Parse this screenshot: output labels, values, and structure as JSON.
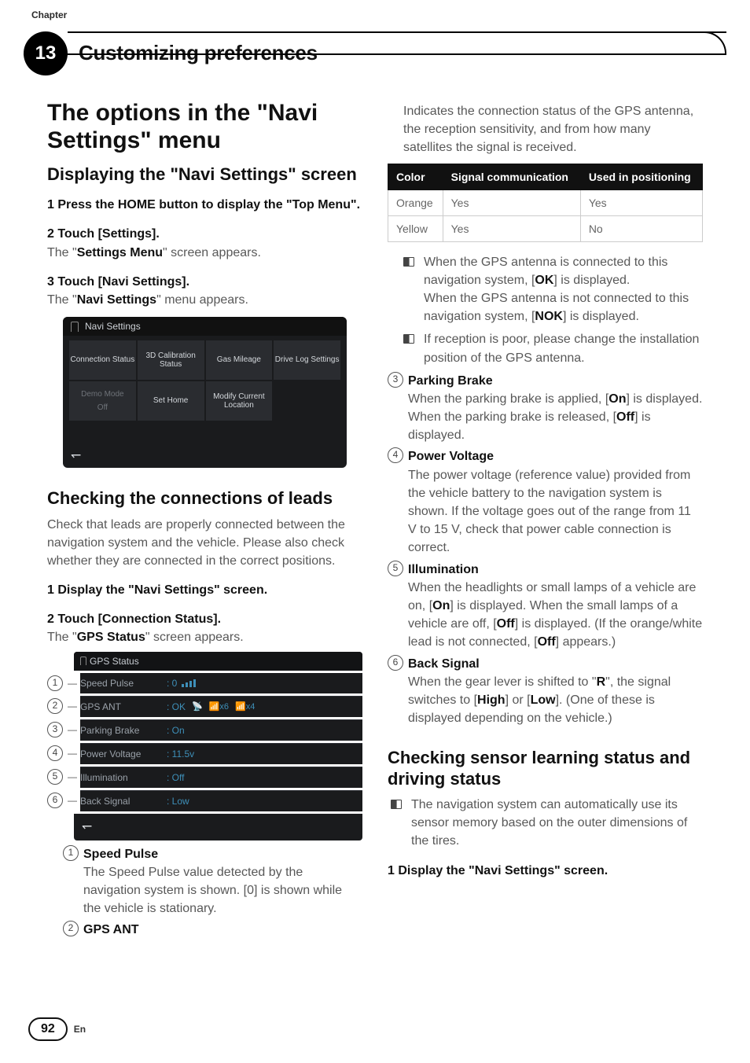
{
  "chapter_label": "Chapter",
  "chapter_number": "13",
  "header_title": "Customizing preferences",
  "left": {
    "h1_a": "The options in the \"",
    "h1_b": "Navi Settings",
    "h1_c": "\" menu",
    "h2a_a": "Displaying the \"",
    "h2a_b": "Navi Settings",
    "h2a_c": "\" screen",
    "step1": "1    Press the HOME button to display the \"Top Menu\".",
    "step2": "2    Touch [Settings].",
    "step2_body_a": "The \"",
    "step2_body_b": "Settings Menu",
    "step2_body_c": "\" screen appears.",
    "step3": "3    Touch [Navi Settings].",
    "step3_body_a": "The \"",
    "step3_body_b": "Navi Settings",
    "step3_body_c": "\" menu appears.",
    "ns_title": "Navi Settings",
    "ns_tiles": {
      "t1": "Connection Status",
      "t2": "3D Calibration Status",
      "t3": "Gas Mileage",
      "t4": "Drive Log Settings",
      "t5a": "Demo Mode",
      "t5b": "Off",
      "t6": "Set Home",
      "t7": "Modify Current Location"
    },
    "h2b": "Checking the connections of leads",
    "p_leads": "Check that leads are properly connected between the navigation system and the vehicle. Please also check whether they are connected in the correct positions.",
    "stepA": "1    Display the \"Navi Settings\" screen.",
    "stepB": "2    Touch [Connection Status].",
    "stepB_body_a": "The \"",
    "stepB_body_b": "GPS Status",
    "stepB_body_c": "\" screen appears.",
    "gps_title": "GPS Status",
    "gps_rows": {
      "r1l": "Speed Pulse",
      "r1v": ": 0",
      "r2l": "GPS ANT",
      "r2v": ": OK",
      "r3l": "Parking Brake",
      "r3v": ": On",
      "r4l": "Power Voltage",
      "r4v": ": 11.5v",
      "r5l": "Illumination",
      "r5v": ": Off",
      "r6l": "Back Signal",
      "r6v": ": Low"
    },
    "gps_idx": {
      "n1": "1",
      "n2": "2",
      "n3": "3",
      "n4": "4",
      "n5": "5",
      "n6": "6"
    },
    "gps_sat6": "x6",
    "gps_sat4": "x4",
    "enum1_label": "Speed Pulse",
    "enum1_body": "The Speed Pulse value detected by the navigation system is shown. [0] is shown while the vehicle is stationary.",
    "enum2_label": "GPS ANT"
  },
  "right": {
    "intro": "Indicates the connection status of the GPS antenna, the reception sensitivity, and from how many satellites the signal is received.",
    "table": {
      "h1": "Color",
      "h2": "Signal communication",
      "h3": "Used in positioning",
      "r1c1": "Orange",
      "r1c2": "Yes",
      "r1c3": "Yes",
      "r2c1": "Yellow",
      "r2c2": "Yes",
      "r2c3": "No"
    },
    "bul1_a": "When the GPS antenna is connected to this navigation system, [",
    "bul1_b": "OK",
    "bul1_c": "] is displayed.",
    "bul1_d": "When the GPS antenna is not connected to this navigation system, [",
    "bul1_e": "NOK",
    "bul1_f": "] is displayed.",
    "bul2": "If reception is poor, please change the installation position of the GPS antenna.",
    "enum3_label": "Parking Brake",
    "enum3_a": "When the parking brake is applied, [",
    "enum3_b": "On",
    "enum3_c": "] is displayed. When the parking brake is released, [",
    "enum3_d": "Off",
    "enum3_e": "] is displayed.",
    "enum4_label": "Power Voltage",
    "enum4_body": "The power voltage (reference value) provided from the vehicle battery to the navigation system is shown. If the voltage goes out of the range from 11 V to 15 V, check that power cable connection is correct.",
    "enum5_label": "Illumination",
    "enum5_a": "When the headlights or small lamps of a vehicle are on, [",
    "enum5_b": "On",
    "enum5_c": "] is displayed. When the small lamps of a vehicle are off, [",
    "enum5_d": "Off",
    "enum5_e": "] is displayed. (If the orange/white lead is not connected, [",
    "enum5_f": "Off",
    "enum5_g": "] appears.)",
    "enum6_label": "Back Signal",
    "enum6_a": "When the gear lever is shifted to \"",
    "enum6_b": "R",
    "enum6_c": "\", the signal switches to [",
    "enum6_d": "High",
    "enum6_e": "] or [",
    "enum6_f": "Low",
    "enum6_g": "]. (One of these is displayed depending on the vehicle.)",
    "circ": {
      "n3": "3",
      "n4": "4",
      "n5": "5",
      "n6": "6"
    },
    "h2c": "Checking sensor learning status and driving status",
    "bul_sensor": "The navigation system can automatically use its sensor memory based on the outer dimensions of the tires.",
    "stepC": "1    Display the \"Navi Settings\" screen."
  },
  "footer": {
    "page": "92",
    "lang": "En"
  },
  "icons": {
    "back": "↽"
  }
}
